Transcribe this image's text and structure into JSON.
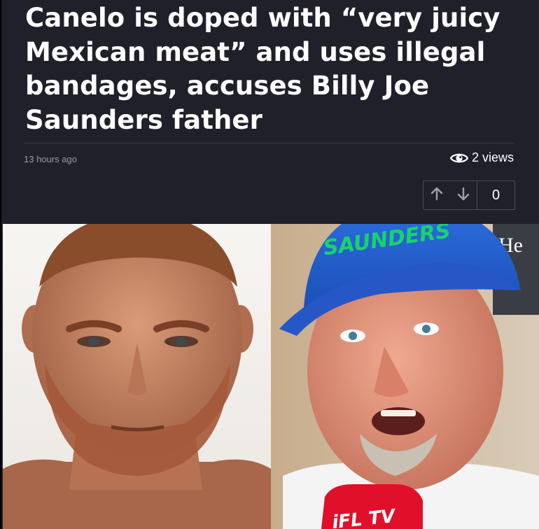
{
  "article": {
    "title": "Canelo is doped with “very juicy Mexican meat” and uses illegal bandages, accuses Billy Joe Saunders father",
    "time_ago": "13 hours ago",
    "views": "2 views",
    "vote_count": "0"
  },
  "image": {
    "cap_text": "SAUNDERS",
    "mic_text": "iFL TV",
    "backdrop_text": "He"
  },
  "icons": {
    "views": "eye-icon",
    "upvote": "arrow-up-icon",
    "downvote": "arrow-down-icon"
  },
  "colors": {
    "background": "#1f202a",
    "text": "#ffffff",
    "muted": "#9a9aa6",
    "border": "#4a4b56"
  }
}
